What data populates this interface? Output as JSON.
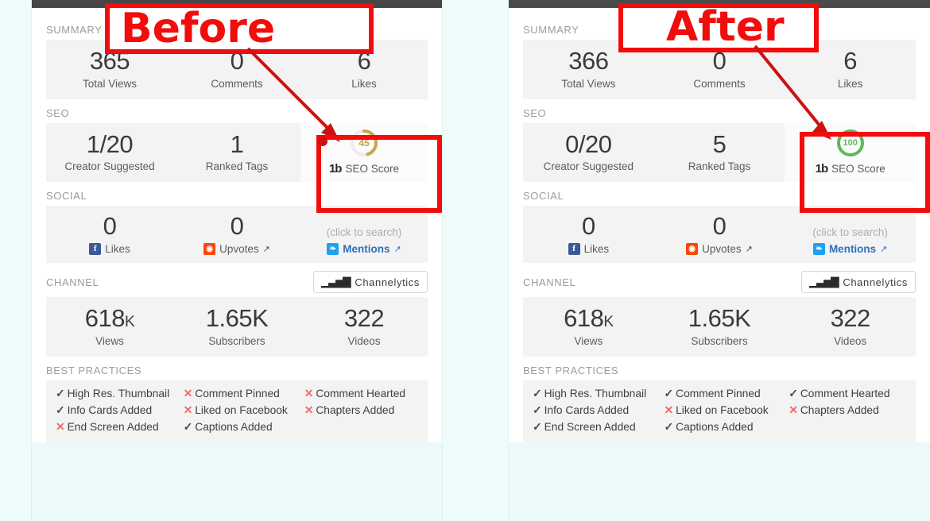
{
  "annotations": {
    "before_label": "Before",
    "after_label": "After"
  },
  "panels": [
    {
      "id": "before",
      "sections": {
        "summary": {
          "label": "SUMMARY",
          "cells": [
            {
              "value": "365",
              "caption": "Total Views"
            },
            {
              "value": "0",
              "caption": "Comments"
            },
            {
              "value": "6",
              "caption": "Likes"
            }
          ]
        },
        "seo": {
          "label": "SEO",
          "cells": [
            {
              "value": "1/20",
              "caption": "Creator Suggested"
            },
            {
              "value": "1",
              "caption": "Ranked Tags"
            }
          ],
          "score": {
            "value": "45",
            "percent": 45,
            "color": "#c9a54d",
            "brand": "1b",
            "caption": "SEO Score"
          }
        },
        "social": {
          "label": "SOCIAL",
          "cells": [
            {
              "value": "0",
              "caption": "Likes",
              "icon": "facebook-icon",
              "glyph": "f",
              "color": "#3b5998",
              "external": false
            },
            {
              "value": "0",
              "caption": "Upvotes",
              "icon": "reddit-icon",
              "glyph": "◉",
              "color": "#ff4500",
              "external": true
            },
            {
              "value": "(click to search)",
              "caption": "Mentions",
              "icon": "twitter-icon",
              "glyph": "❧",
              "color": "#1da1f2",
              "external": true,
              "muted": true,
              "link": true
            }
          ]
        },
        "channel": {
          "label": "CHANNEL",
          "button": {
            "label": "Channelytics",
            "icon": "bar-chart-icon"
          },
          "cells": [
            {
              "value": "618",
              "suffix": "K",
              "caption": "Views"
            },
            {
              "value": "1.65K",
              "suffix": "",
              "caption": "Subscribers"
            },
            {
              "value": "322",
              "suffix": "",
              "caption": "Videos"
            }
          ]
        },
        "best_practices": {
          "label": "BEST PRACTICES",
          "items": [
            {
              "label": "High Res. Thumbnail",
              "done": true
            },
            {
              "label": "Comment Pinned",
              "done": false
            },
            {
              "label": "Comment Hearted",
              "done": false
            },
            {
              "label": "Info Cards Added",
              "done": true
            },
            {
              "label": "Liked on Facebook",
              "done": false
            },
            {
              "label": "Chapters Added",
              "done": false
            },
            {
              "label": "End Screen Added",
              "done": false
            },
            {
              "label": "Captions Added",
              "done": true
            }
          ]
        }
      }
    },
    {
      "id": "after",
      "sections": {
        "summary": {
          "label": "SUMMARY",
          "cells": [
            {
              "value": "366",
              "caption": "Total Views"
            },
            {
              "value": "0",
              "caption": "Comments"
            },
            {
              "value": "6",
              "caption": "Likes"
            }
          ]
        },
        "seo": {
          "label": "SEO",
          "cells": [
            {
              "value": "0/20",
              "caption": "Creator Suggested"
            },
            {
              "value": "5",
              "caption": "Ranked Tags"
            }
          ],
          "score": {
            "value": "100",
            "percent": 100,
            "color": "#5cb85c",
            "brand": "1b",
            "caption": "SEO Score"
          }
        },
        "social": {
          "label": "SOCIAL",
          "cells": [
            {
              "value": "0",
              "caption": "Likes",
              "icon": "facebook-icon",
              "glyph": "f",
              "color": "#3b5998",
              "external": false
            },
            {
              "value": "0",
              "caption": "Upvotes",
              "icon": "reddit-icon",
              "glyph": "◉",
              "color": "#ff4500",
              "external": true
            },
            {
              "value": "(click to search)",
              "caption": "Mentions",
              "icon": "twitter-icon",
              "glyph": "❧",
              "color": "#1da1f2",
              "external": true,
              "muted": true,
              "link": true
            }
          ]
        },
        "channel": {
          "label": "CHANNEL",
          "button": {
            "label": "Channelytics",
            "icon": "bar-chart-icon"
          },
          "cells": [
            {
              "value": "618",
              "suffix": "K",
              "caption": "Views"
            },
            {
              "value": "1.65K",
              "suffix": "",
              "caption": "Subscribers"
            },
            {
              "value": "322",
              "suffix": "",
              "caption": "Videos"
            }
          ]
        },
        "best_practices": {
          "label": "BEST PRACTICES",
          "items": [
            {
              "label": "High Res. Thumbnail",
              "done": true
            },
            {
              "label": "Comment Pinned",
              "done": true
            },
            {
              "label": "Comment Hearted",
              "done": true
            },
            {
              "label": "Info Cards Added",
              "done": true
            },
            {
              "label": "Liked on Facebook",
              "done": false
            },
            {
              "label": "Chapters Added",
              "done": false
            },
            {
              "label": "End Screen Added",
              "done": true
            },
            {
              "label": "Captions Added",
              "done": true
            }
          ]
        }
      }
    }
  ]
}
